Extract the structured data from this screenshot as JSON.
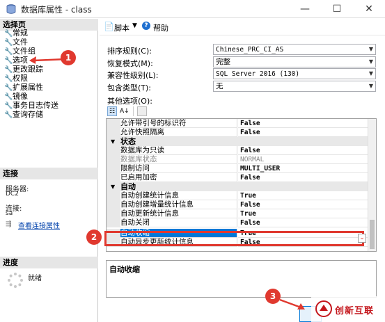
{
  "window": {
    "title": "数据库属性 - class",
    "minimize": "—",
    "maximize": "☐",
    "close": "✕"
  },
  "left": {
    "select_page_header": "选择页",
    "pages": [
      "常规",
      "文件",
      "文件组",
      "选项",
      "更改跟踪",
      "权限",
      "扩展属性",
      "镜像",
      "事务日志传送",
      "查询存储"
    ],
    "connection_header": "连接",
    "server_label": "服务器:",
    "server_value": "DC2",
    "connection_label": "连接:",
    "connection_value": "sa",
    "view_connection_link": "查看连接属性",
    "progress_header": "进度",
    "progress_status": "就绪"
  },
  "toolbar": {
    "script_label": "脚本",
    "help_label": "帮助"
  },
  "form": {
    "collation_label": "排序规则(C):",
    "collation_value": "Chinese_PRC_CI_AS",
    "recovery_label": "恢复模式(M):",
    "recovery_value": "完整",
    "compat_label": "兼容性级别(L):",
    "compat_value": "SQL Server 2016 (130)",
    "containment_label": "包含类型(T):",
    "containment_value": "无",
    "other_options_label": "其他选项(O):"
  },
  "grid": {
    "rows": [
      {
        "type": "prop",
        "name": "允许带引号的标识符",
        "value": "False"
      },
      {
        "type": "prop",
        "name": "允许快照隔离",
        "value": "False"
      },
      {
        "type": "cat",
        "name": "状态"
      },
      {
        "type": "prop",
        "name": "数据库为只读",
        "value": "False"
      },
      {
        "type": "prop",
        "name": "数据库状态",
        "value": "NORMAL",
        "disabled": true
      },
      {
        "type": "prop",
        "name": "限制访问",
        "value": "MULTI_USER"
      },
      {
        "type": "prop",
        "name": "已启用加密",
        "value": "False"
      },
      {
        "type": "cat",
        "name": "自动"
      },
      {
        "type": "prop",
        "name": "自动创建统计信息",
        "value": "True"
      },
      {
        "type": "prop",
        "name": "自动创建增量统计信息",
        "value": "False"
      },
      {
        "type": "prop",
        "name": "自动更新统计信息",
        "value": "True"
      },
      {
        "type": "prop",
        "name": "自动关闭",
        "value": "False"
      },
      {
        "type": "prop",
        "name": "自动收缩",
        "value": "True",
        "selected": true
      },
      {
        "type": "prop",
        "name": "自动异步更新统计信息",
        "value": "False"
      }
    ]
  },
  "description": {
    "title": "自动收缩"
  },
  "annotations": {
    "step1": "1",
    "step2": "2",
    "step3": "3"
  },
  "watermark": "创新互联",
  "colors": {
    "selected_row": "#0078d7",
    "annotation_red": "#e0392f",
    "category_bg": "#e8e8e8"
  }
}
